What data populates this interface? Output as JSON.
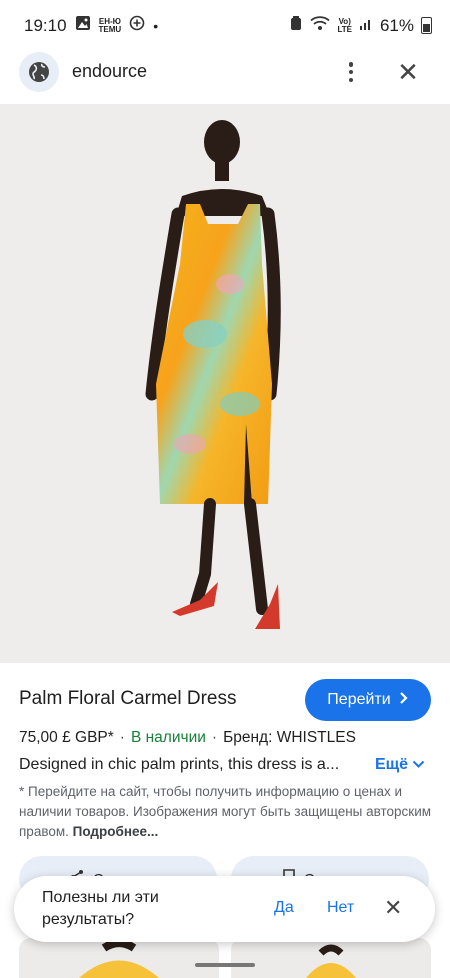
{
  "status_bar": {
    "time": "19:10",
    "notif_mini": "ЕН-Ю\nTEMU",
    "volte_mini": "Vo)\nLTE",
    "battery": "61%"
  },
  "header": {
    "site_name": "endource",
    "icons": [
      "globe-icon",
      "more-vert-icon",
      "close-icon"
    ]
  },
  "product": {
    "title": "Palm Floral Carmel Dress",
    "go_label": "Перейти",
    "price": "75,00 £ GBP*",
    "stock": "В наличии",
    "brand": "Бренд: WHISTLES",
    "description": "Designed in chic palm prints, this dress is a...",
    "more_label": "Ещё",
    "disclaimer": "* Перейдите на сайт, чтобы получить информацию о ценах и наличии товаров. Изображения могут быть защищены авторским правом.",
    "disclaimer_link": "Подробнее..."
  },
  "actions": {
    "share": "Отправить",
    "save": "Сохранить"
  },
  "feedback": {
    "question": "Полезны ли эти результаты?",
    "yes": "Да",
    "no": "Нет"
  },
  "colors": {
    "accent": "#1a73e8",
    "stock_green": "#188038",
    "image_bg": "#eeedeb"
  }
}
